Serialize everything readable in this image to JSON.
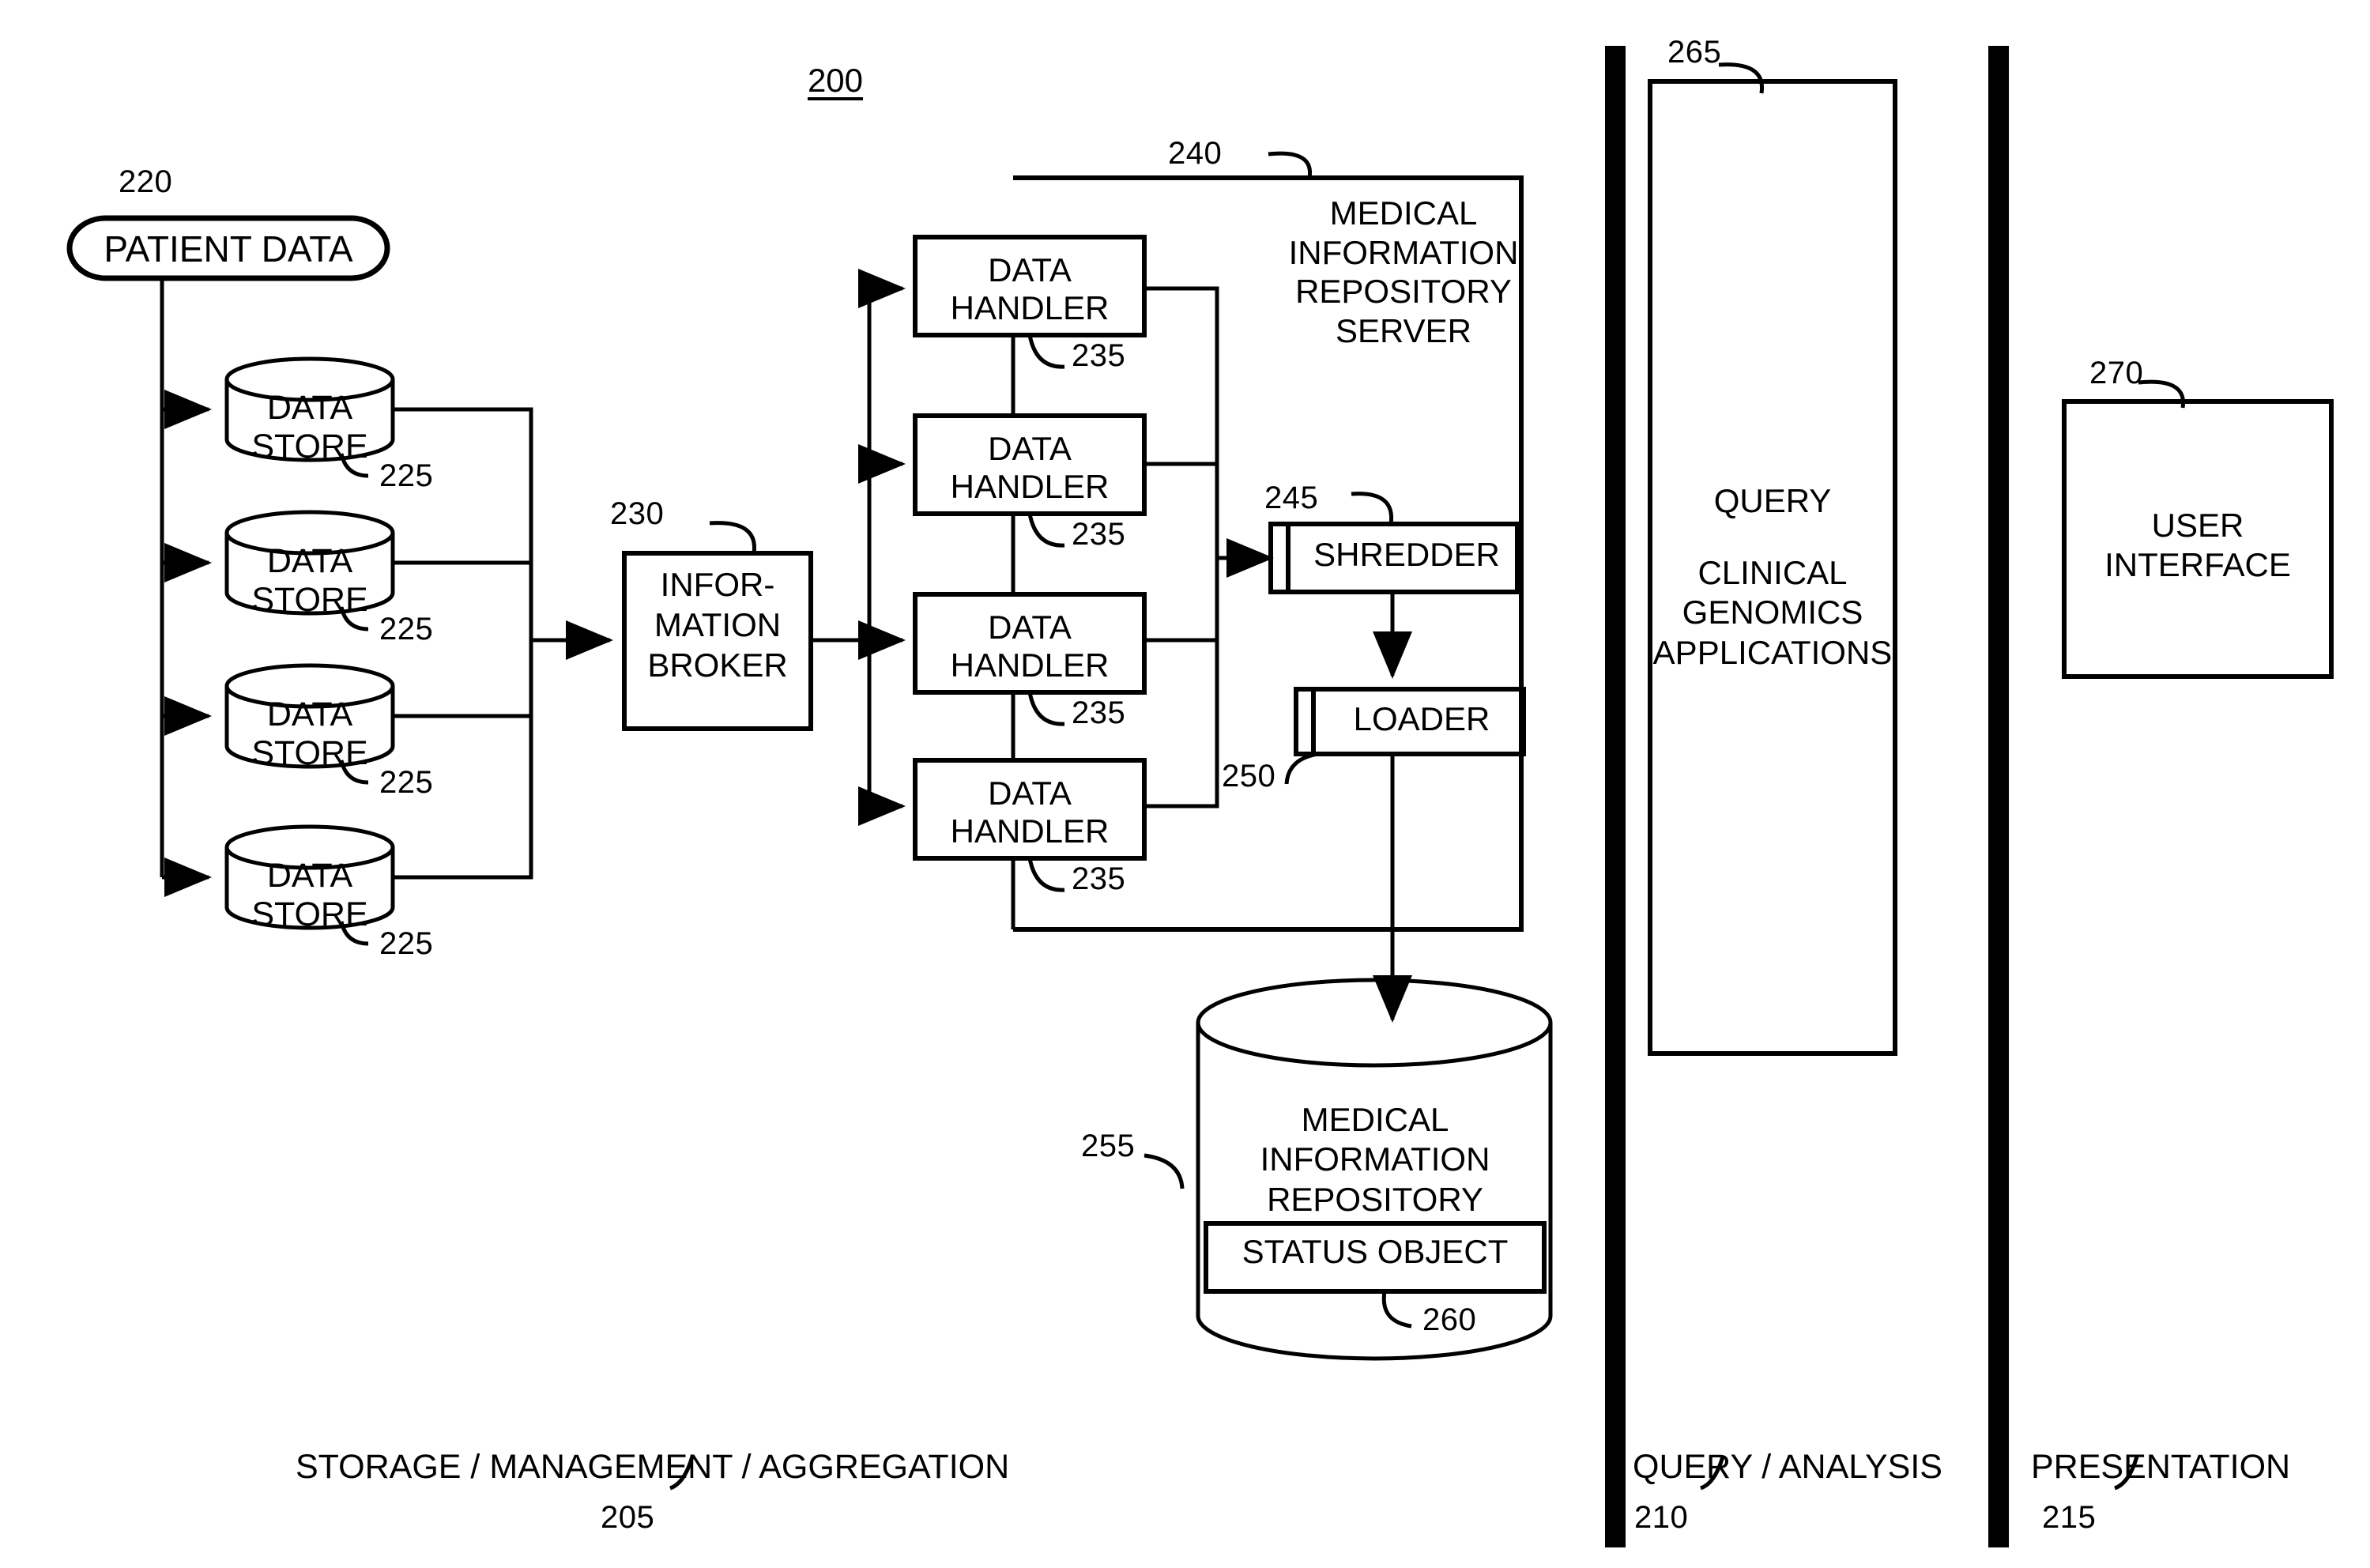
{
  "figure": {
    "number": "200"
  },
  "sections": [
    {
      "id": "storage",
      "label": "STORAGE / MANAGEMENT / AGGREGATION",
      "ref": "205"
    },
    {
      "id": "query",
      "label": "QUERY / ANALYSIS",
      "ref": "210"
    },
    {
      "id": "presentation",
      "label": "PRESENTATION",
      "ref": "215"
    }
  ],
  "nodes": {
    "patient_data": {
      "label": "PATIENT DATA",
      "ref": "220"
    },
    "data_stores": [
      {
        "label": "DATA STORE",
        "ref": "225"
      },
      {
        "label": "DATA STORE",
        "ref": "225"
      },
      {
        "label": "DATA STORE",
        "ref": "225"
      },
      {
        "label": "DATA STORE",
        "ref": "225"
      }
    ],
    "information_broker": {
      "label": "INFOR-\nMATION\nBROKER",
      "ref": "230"
    },
    "data_handlers": [
      {
        "label": "DATA\nHANDLER",
        "ref": "235"
      },
      {
        "label": "DATA\nHANDLER",
        "ref": "235"
      },
      {
        "label": "DATA\nHANDLER",
        "ref": "235"
      },
      {
        "label": "DATA\nHANDLER",
        "ref": "235"
      }
    ],
    "mir_server": {
      "label": "MEDICAL\nINFORMATION\nREPOSITORY\nSERVER",
      "ref": "240"
    },
    "shredder": {
      "label": "SHREDDER",
      "ref": "245"
    },
    "loader": {
      "label": "LOADER",
      "ref": "250"
    },
    "mir_store": {
      "label": "MEDICAL\nINFORMATION\nREPOSITORY",
      "ref": "255"
    },
    "status_object": {
      "label": "STATUS OBJECT",
      "ref": "260"
    },
    "clinical_apps": {
      "label_top": "QUERY",
      "label_body": "CLINICAL\nGENOMICS\nAPPLICATIONS",
      "ref": "265"
    },
    "user_interface": {
      "label": "USER\nINTERFACE",
      "ref": "270"
    }
  },
  "colors": {
    "ink": "#000000",
    "paper": "#ffffff"
  }
}
